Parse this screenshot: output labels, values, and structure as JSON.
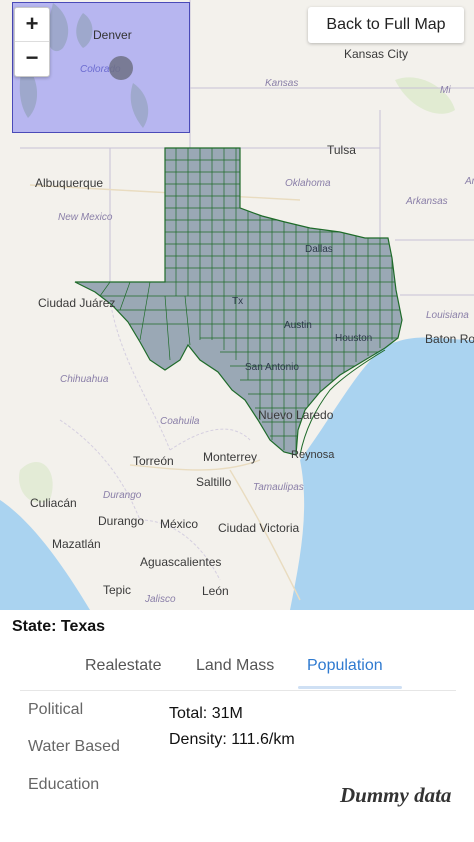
{
  "map": {
    "zoom_in": "+",
    "zoom_out": "−",
    "back_button": "Back to Full Map",
    "cities": {
      "denver": "Denver",
      "kansas_city": "Kansas City",
      "tulsa": "Tulsa",
      "albuquerque": "Albuquerque",
      "ciudad_juarez": "Ciudad Juárez",
      "baton_rouge": "Baton Rouge",
      "torreon": "Torreón",
      "monterrey": "Monterrey",
      "saltillo": "Saltillo",
      "culiacan": "Culiacán",
      "durango": "Durango",
      "mexico": "México",
      "ciudad_victoria": "Ciudad Victoria",
      "mazatlan": "Mazatlán",
      "aguascalientes": "Aguascalientes",
      "tepic": "Tepic",
      "leon": "León",
      "dallas": "Dallas",
      "houston": "Houston",
      "austin": "Austin",
      "san_antonio": "San Antonio",
      "nuevo_laredo": "Nuevo Laredo",
      "reynosa": "Reynosa",
      "tx": "Tx"
    },
    "regions": {
      "colorado": "Colorado",
      "kansas": "Kansas",
      "missouri": "Mi",
      "oklahoma": "Oklahoma",
      "arkansas": "Arkansas",
      "new_mexico": "New Mexico",
      "louisiana": "Louisiana",
      "chihuahua": "Chihuahua",
      "coahuila": "Coahuila",
      "durango_state": "Durango",
      "tamaulipas": "Tamaulipas",
      "jalisco": "Jalisco",
      "ar": "Ar"
    }
  },
  "panel": {
    "state_label": "State: Texas",
    "tabs": [
      "Realestate",
      "Land Mass",
      "Population"
    ],
    "active_tab": "Population",
    "categories": [
      "Political",
      "Water Based",
      "Education"
    ],
    "stats": {
      "total": "Total: 31M",
      "density": "Density: 111.6/km"
    },
    "watermark": "Dummy data"
  },
  "colors": {
    "texas_fill": "#9aa8b5",
    "county_lines": "#1f6b2a",
    "gulf": "#aad3f0",
    "inset_fill": "#b7b6f0",
    "active_tab": "#2f7ad0"
  }
}
